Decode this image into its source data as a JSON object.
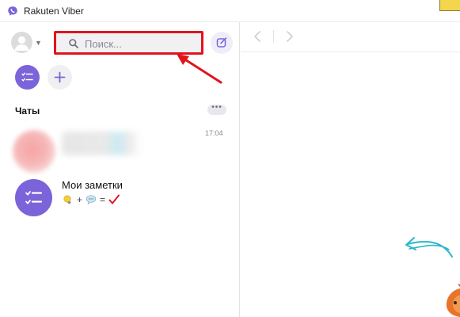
{
  "window": {
    "title": "Rakuten Viber"
  },
  "sidebar": {
    "search": {
      "placeholder": "Поиск..."
    },
    "section_title": "Чаты",
    "more_label": "•••",
    "chats": [
      {
        "name": "",
        "time": "17:04"
      },
      {
        "name": "Мои заметки",
        "preview_ops": [
          "+",
          "="
        ]
      }
    ]
  },
  "colors": {
    "accent": "#7b63d9",
    "highlight_box": "#e1141b",
    "hint_arrow": "#2bb8c9"
  },
  "icons": [
    "viber-logo-icon",
    "user-avatar-icon",
    "search-icon",
    "compose-icon",
    "notes-list-icon",
    "plus-icon",
    "more-icon",
    "lightbulb-icon",
    "speech-bubble-icon",
    "checkmark-icon",
    "arrow-left-icon",
    "arrow-right-icon"
  ]
}
